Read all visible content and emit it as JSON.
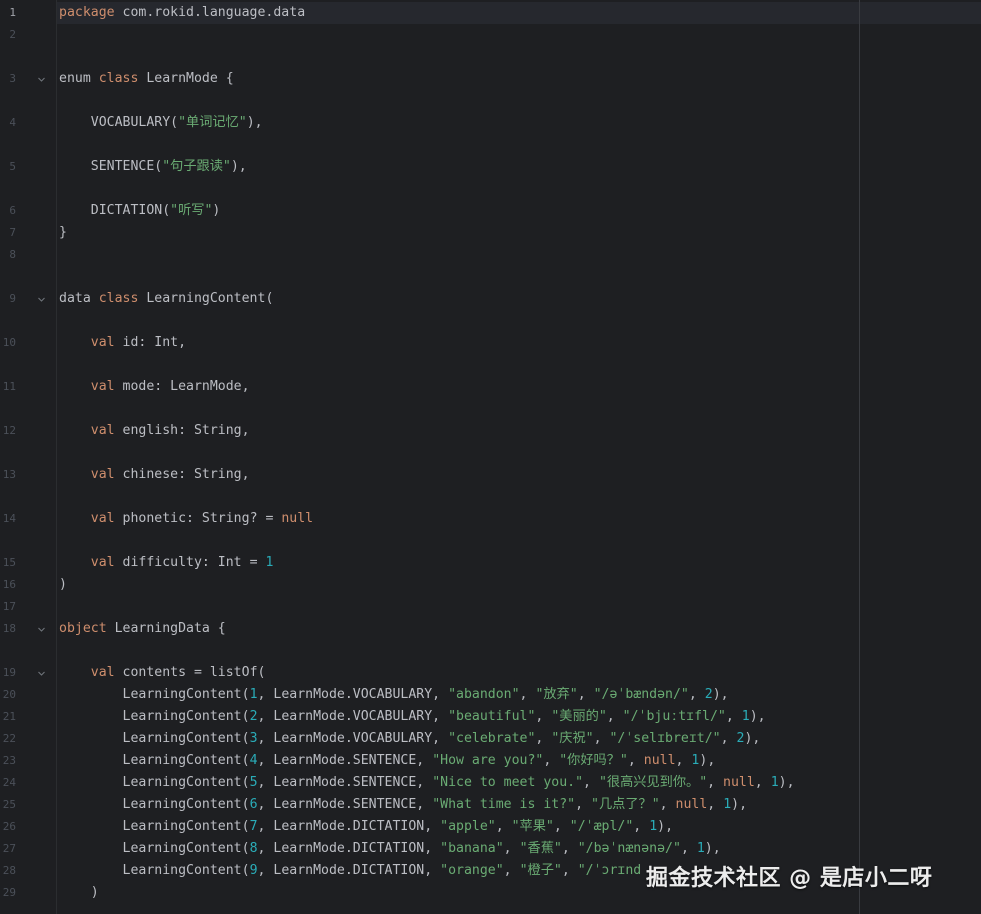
{
  "editor": {
    "current_line": 1,
    "lines": [
      {
        "n": "1",
        "tokens": [
          {
            "t": "kw",
            "v": "package"
          },
          {
            "t": "id",
            "v": " com.rokid.language.data"
          }
        ]
      },
      {
        "n": "2",
        "tokens": []
      },
      {
        "n": "3",
        "fold": true,
        "tokens": [
          {
            "t": "id",
            "v": "enum "
          },
          {
            "t": "kw",
            "v": "class"
          },
          {
            "t": "id",
            "v": " LearnMode {"
          }
        ]
      },
      {
        "n": "4",
        "tokens": [
          {
            "t": "id",
            "v": "    VOCABULARY("
          },
          {
            "t": "str",
            "v": "\"单词记忆\""
          },
          {
            "t": "id",
            "v": "),"
          }
        ]
      },
      {
        "n": "5",
        "tokens": [
          {
            "t": "id",
            "v": "    SENTENCE("
          },
          {
            "t": "str",
            "v": "\"句子跟读\""
          },
          {
            "t": "id",
            "v": "),"
          }
        ]
      },
      {
        "n": "6",
        "tokens": [
          {
            "t": "id",
            "v": "    DICTATION("
          },
          {
            "t": "str",
            "v": "\"听写\""
          },
          {
            "t": "id",
            "v": ")"
          }
        ]
      },
      {
        "n": "7",
        "tokens": [
          {
            "t": "id",
            "v": "}"
          }
        ]
      },
      {
        "n": "8",
        "tokens": []
      },
      {
        "n": "9",
        "fold": true,
        "tokens": [
          {
            "t": "id",
            "v": "data "
          },
          {
            "t": "kw",
            "v": "class"
          },
          {
            "t": "id",
            "v": " LearningContent("
          }
        ]
      },
      {
        "n": "10",
        "tokens": [
          {
            "t": "id",
            "v": "    "
          },
          {
            "t": "kw",
            "v": "val"
          },
          {
            "t": "id",
            "v": " id: Int,"
          }
        ]
      },
      {
        "n": "11",
        "tokens": [
          {
            "t": "id",
            "v": "    "
          },
          {
            "t": "kw",
            "v": "val"
          },
          {
            "t": "id",
            "v": " mode: LearnMode,"
          }
        ]
      },
      {
        "n": "12",
        "tokens": [
          {
            "t": "id",
            "v": "    "
          },
          {
            "t": "kw",
            "v": "val"
          },
          {
            "t": "id",
            "v": " english: String,"
          }
        ]
      },
      {
        "n": "13",
        "tokens": [
          {
            "t": "id",
            "v": "    "
          },
          {
            "t": "kw",
            "v": "val"
          },
          {
            "t": "id",
            "v": " chinese: String,"
          }
        ]
      },
      {
        "n": "14",
        "tokens": [
          {
            "t": "id",
            "v": "    "
          },
          {
            "t": "kw",
            "v": "val"
          },
          {
            "t": "id",
            "v": " phonetic: String? = "
          },
          {
            "t": "kw",
            "v": "null"
          }
        ]
      },
      {
        "n": "15",
        "tokens": [
          {
            "t": "id",
            "v": "    "
          },
          {
            "t": "kw",
            "v": "val"
          },
          {
            "t": "id",
            "v": " difficulty: Int = "
          },
          {
            "t": "num",
            "v": "1"
          }
        ]
      },
      {
        "n": "16",
        "tokens": [
          {
            "t": "id",
            "v": ")"
          }
        ]
      },
      {
        "n": "17",
        "tokens": []
      },
      {
        "n": "18",
        "fold": true,
        "tokens": [
          {
            "t": "kw",
            "v": "object"
          },
          {
            "t": "id",
            "v": " LearningData {"
          }
        ]
      },
      {
        "n": "19",
        "fold": true,
        "tokens": [
          {
            "t": "id",
            "v": "    "
          },
          {
            "t": "kw",
            "v": "val"
          },
          {
            "t": "id",
            "v": " contents = listOf("
          }
        ]
      },
      {
        "n": "20",
        "tokens": [
          {
            "t": "id",
            "v": "        LearningContent("
          },
          {
            "t": "num",
            "v": "1"
          },
          {
            "t": "id",
            "v": ", LearnMode.VOCABULARY, "
          },
          {
            "t": "str",
            "v": "\"abandon\""
          },
          {
            "t": "id",
            "v": ", "
          },
          {
            "t": "str",
            "v": "\"放弃\""
          },
          {
            "t": "id",
            "v": ", "
          },
          {
            "t": "str",
            "v": "\"/əˈbændən/\""
          },
          {
            "t": "id",
            "v": ", "
          },
          {
            "t": "num",
            "v": "2"
          },
          {
            "t": "id",
            "v": "),"
          }
        ]
      },
      {
        "n": "21",
        "tokens": [
          {
            "t": "id",
            "v": "        LearningContent("
          },
          {
            "t": "num",
            "v": "2"
          },
          {
            "t": "id",
            "v": ", LearnMode.VOCABULARY, "
          },
          {
            "t": "str",
            "v": "\"beautiful\""
          },
          {
            "t": "id",
            "v": ", "
          },
          {
            "t": "str",
            "v": "\"美丽的\""
          },
          {
            "t": "id",
            "v": ", "
          },
          {
            "t": "str",
            "v": "\"/ˈbjuːtɪfl/\""
          },
          {
            "t": "id",
            "v": ", "
          },
          {
            "t": "num",
            "v": "1"
          },
          {
            "t": "id",
            "v": "),"
          }
        ]
      },
      {
        "n": "22",
        "tokens": [
          {
            "t": "id",
            "v": "        LearningContent("
          },
          {
            "t": "num",
            "v": "3"
          },
          {
            "t": "id",
            "v": ", LearnMode.VOCABULARY, "
          },
          {
            "t": "str",
            "v": "\"celebrate\""
          },
          {
            "t": "id",
            "v": ", "
          },
          {
            "t": "str",
            "v": "\"庆祝\""
          },
          {
            "t": "id",
            "v": ", "
          },
          {
            "t": "str",
            "v": "\"/ˈselɪbreɪt/\""
          },
          {
            "t": "id",
            "v": ", "
          },
          {
            "t": "num",
            "v": "2"
          },
          {
            "t": "id",
            "v": "),"
          }
        ]
      },
      {
        "n": "23",
        "tokens": [
          {
            "t": "id",
            "v": "        LearningContent("
          },
          {
            "t": "num",
            "v": "4"
          },
          {
            "t": "id",
            "v": ", LearnMode.SENTENCE, "
          },
          {
            "t": "str",
            "v": "\"How are you?\""
          },
          {
            "t": "id",
            "v": ", "
          },
          {
            "t": "str",
            "v": "\"你好吗？\""
          },
          {
            "t": "id",
            "v": ", "
          },
          {
            "t": "kw",
            "v": "null"
          },
          {
            "t": "id",
            "v": ", "
          },
          {
            "t": "num",
            "v": "1"
          },
          {
            "t": "id",
            "v": "),"
          }
        ]
      },
      {
        "n": "24",
        "tokens": [
          {
            "t": "id",
            "v": "        LearningContent("
          },
          {
            "t": "num",
            "v": "5"
          },
          {
            "t": "id",
            "v": ", LearnMode.SENTENCE, "
          },
          {
            "t": "str",
            "v": "\"Nice to meet you.\""
          },
          {
            "t": "id",
            "v": ", "
          },
          {
            "t": "str",
            "v": "\"很高兴见到你。\""
          },
          {
            "t": "id",
            "v": ", "
          },
          {
            "t": "kw",
            "v": "null"
          },
          {
            "t": "id",
            "v": ", "
          },
          {
            "t": "num",
            "v": "1"
          },
          {
            "t": "id",
            "v": "),"
          }
        ]
      },
      {
        "n": "25",
        "tokens": [
          {
            "t": "id",
            "v": "        LearningContent("
          },
          {
            "t": "num",
            "v": "6"
          },
          {
            "t": "id",
            "v": ", LearnMode.SENTENCE, "
          },
          {
            "t": "str",
            "v": "\"What time is it?\""
          },
          {
            "t": "id",
            "v": ", "
          },
          {
            "t": "str",
            "v": "\"几点了？\""
          },
          {
            "t": "id",
            "v": ", "
          },
          {
            "t": "kw",
            "v": "null"
          },
          {
            "t": "id",
            "v": ", "
          },
          {
            "t": "num",
            "v": "1"
          },
          {
            "t": "id",
            "v": "),"
          }
        ]
      },
      {
        "n": "26",
        "tokens": [
          {
            "t": "id",
            "v": "        LearningContent("
          },
          {
            "t": "num",
            "v": "7"
          },
          {
            "t": "id",
            "v": ", LearnMode.DICTATION, "
          },
          {
            "t": "str",
            "v": "\"apple\""
          },
          {
            "t": "id",
            "v": ", "
          },
          {
            "t": "str",
            "v": "\"苹果\""
          },
          {
            "t": "id",
            "v": ", "
          },
          {
            "t": "str",
            "v": "\"/ˈæpl/\""
          },
          {
            "t": "id",
            "v": ", "
          },
          {
            "t": "num",
            "v": "1"
          },
          {
            "t": "id",
            "v": "),"
          }
        ]
      },
      {
        "n": "27",
        "tokens": [
          {
            "t": "id",
            "v": "        LearningContent("
          },
          {
            "t": "num",
            "v": "8"
          },
          {
            "t": "id",
            "v": ", LearnMode.DICTATION, "
          },
          {
            "t": "str",
            "v": "\"banana\""
          },
          {
            "t": "id",
            "v": ", "
          },
          {
            "t": "str",
            "v": "\"香蕉\""
          },
          {
            "t": "id",
            "v": ", "
          },
          {
            "t": "str",
            "v": "\"/bəˈnænənə/\""
          },
          {
            "t": "id",
            "v": ", "
          },
          {
            "t": "num",
            "v": "1"
          },
          {
            "t": "id",
            "v": "),"
          }
        ]
      },
      {
        "n": "28",
        "tokens": [
          {
            "t": "id",
            "v": "        LearningContent("
          },
          {
            "t": "num",
            "v": "9"
          },
          {
            "t": "id",
            "v": ", LearnMode.DICTATION, "
          },
          {
            "t": "str",
            "v": "\"orange\""
          },
          {
            "t": "id",
            "v": ", "
          },
          {
            "t": "str",
            "v": "\"橙子\""
          },
          {
            "t": "id",
            "v": ", "
          },
          {
            "t": "str",
            "v": "\"/ˈɔrɪnd"
          }
        ]
      },
      {
        "n": "29",
        "tokens": [
          {
            "t": "id",
            "v": "    )"
          }
        ]
      }
    ]
  },
  "watermark": "掘金技术社区 @ 是店小二呀",
  "colors": {
    "background": "#1e1f22",
    "keyword": "#cf8e6d",
    "string": "#6aab73",
    "number": "#2aacb8",
    "identifier": "#bcbec4",
    "line_number": "#4b5059"
  }
}
